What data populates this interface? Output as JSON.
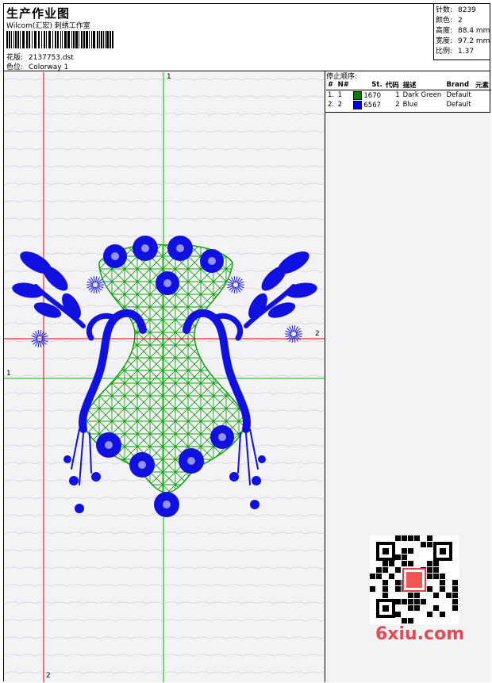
{
  "header": {
    "title": "生产作业图",
    "subtitle": "Wilcom(汇宏) 刺绣工作室",
    "design_label": "花版:",
    "design_file": "2137753.dst",
    "colorway_label": "色位:",
    "colorway": "Colorway 1"
  },
  "stats": {
    "stitches_label": "针数:",
    "stitches": "8239",
    "colors_label": "颜色:",
    "colors": "2",
    "height_label": "高度:",
    "height": "88.4 mm",
    "width_label": "宽度:",
    "width": "97.2 mm",
    "ratio_label": "比例:",
    "ratio": "1.37"
  },
  "stop_sequence": {
    "title": "停止顺序:",
    "columns": [
      "#",
      "N#",
      "St.",
      "代码",
      "描述",
      "Brand",
      "元素"
    ],
    "rows": [
      {
        "index": "1.",
        "n": "1",
        "color": "#008000",
        "stitches": "1670",
        "code": "1",
        "desc": "Dark Green",
        "brand": "Default"
      },
      {
        "index": "2.",
        "n": "2",
        "color": "#0000ee",
        "stitches": "6567",
        "code": "2",
        "desc": "Blue",
        "brand": "Default"
      }
    ]
  },
  "canvas": {
    "guide_marks": {
      "top": "1",
      "right": "2",
      "left": "1",
      "bottom": "2"
    },
    "colors": {
      "vertical_green": "#00c000",
      "horizontal_red": "#e00000",
      "design_blue": "#1010e0",
      "fill_green": "#10a010"
    }
  },
  "watermark": {
    "text": "6xiu.com",
    "qr_icon": "qr-code-icon"
  }
}
